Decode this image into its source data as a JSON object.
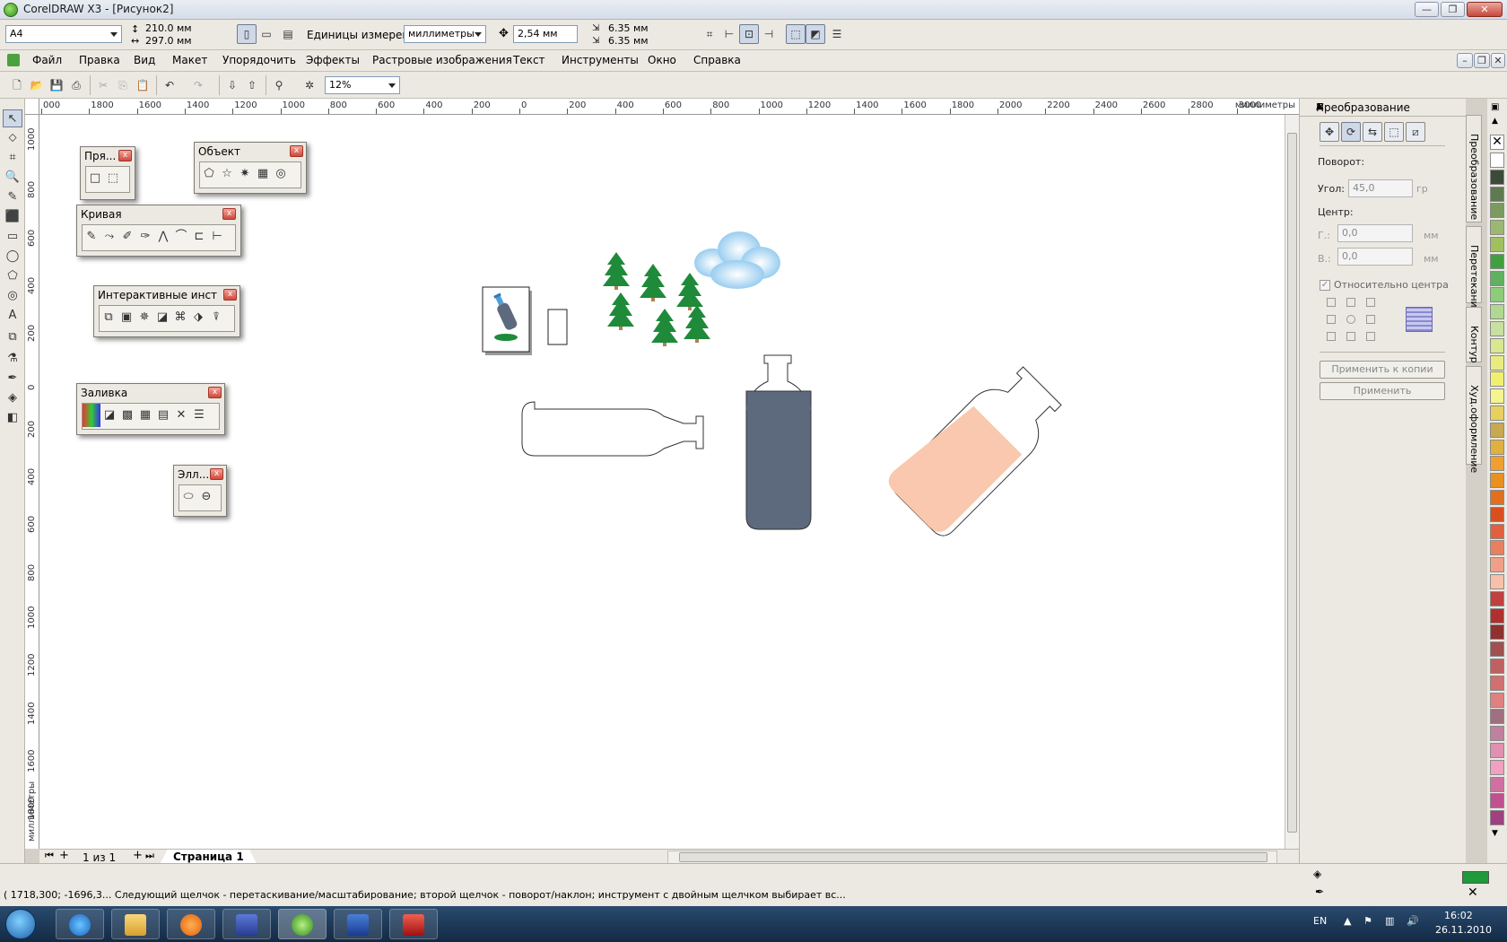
{
  "window": {
    "title": "CorelDRAW X3 - [Рисунок2]",
    "controls": {
      "minimize": "—",
      "restore": "❐",
      "close": "✕"
    }
  },
  "property_bar": {
    "paper_size": "A4",
    "width": "210.0 мм",
    "height": "297.0 мм",
    "units_label": "Единицы измерения:",
    "units_value": "миллиметры",
    "nudge": "2,54 мм",
    "dup_x": "6.35 мм",
    "dup_y": "6.35 мм"
  },
  "menu": {
    "items": [
      "Файл",
      "Правка",
      "Вид",
      "Макет",
      "Упорядочить",
      "Эффекты",
      "Растровые изображения",
      "Текст",
      "Инструменты",
      "Окно",
      "Справка"
    ]
  },
  "standard_bar": {
    "zoom": "12%"
  },
  "ruler": {
    "h_labels": [
      "000",
      "1800",
      "1600",
      "1400",
      "1200",
      "1000",
      "800",
      "600",
      "400",
      "200",
      "0",
      "200",
      "400",
      "600",
      "800",
      "1000",
      "1200",
      "1400",
      "1600",
      "1800",
      "2000",
      "2200",
      "2400",
      "2600",
      "2800",
      "3000"
    ],
    "h_unit": "миллиметры",
    "v_labels": [
      "1000",
      "800",
      "600",
      "400",
      "200",
      "0",
      "200",
      "400",
      "600",
      "800",
      "1000",
      "1200",
      "1400",
      "1600",
      "1800"
    ],
    "v_unit": "миллиметры"
  },
  "palettes": {
    "rect": {
      "title": "Пря..."
    },
    "object": {
      "title": "Объект"
    },
    "curve": {
      "title": "Кривая"
    },
    "interactive": {
      "title": "Интерактивные инструм..."
    },
    "fill": {
      "title": "Заливка"
    },
    "ellipse": {
      "title": "Элл..."
    }
  },
  "page_bar": {
    "count": "1 из 1",
    "tab": "Страница 1"
  },
  "docker": {
    "title": "Преобразование",
    "rotation_label": "Поворот:",
    "angle_label": "Угол:",
    "angle_value": "45,0",
    "angle_unit": "гр",
    "center_label": "Центр:",
    "h_label": "Г.:",
    "h_value": "0,0",
    "h_unit": "мм",
    "v_label": "В.:",
    "v_value": "0,0",
    "v_unit": "мм",
    "relative_label": "Относительно центра",
    "apply_copy": "Применить к копии",
    "apply": "Применить",
    "tabs": [
      "Преобразование",
      "Перетекание",
      "Контур",
      "Худ.оформление"
    ]
  },
  "status": {
    "text": "( 1718,300; -1696,3... Следующий щелчок - перетаскивание/масштабирование; второй щелчок - поворот/наклон; инструмент с двойным щелчком выбирает вс..."
  },
  "taskbar": {
    "lang": "EN",
    "time": "16:02",
    "date": "26.11.2010"
  },
  "colors": {
    "accent": "#5a6a82",
    "bottle_dark": "#5d6a7e",
    "bottle_peach": "#fac8ae",
    "tree_green": "#1f8a3a",
    "cloud_blue": "#9fd0f0"
  },
  "swatches": [
    "#ffffff",
    "#3c4a3a",
    "#5f7a50",
    "#7a9a60",
    "#9cb870",
    "#a0c060",
    "#40a040",
    "#60b060",
    "#8ccc7a",
    "#b0d890",
    "#c8e0a0",
    "#d8e890",
    "#e8ec80",
    "#f0f070",
    "#f4f490",
    "#e8d060",
    "#c8a850",
    "#e0b040",
    "#f0a030",
    "#e89020",
    "#e07020",
    "#d85020",
    "#e06040",
    "#e88060",
    "#f0a088",
    "#f8c0a8",
    "#c04040",
    "#b03030",
    "#903030",
    "#a05050",
    "#c06060",
    "#d07070",
    "#e08080",
    "#a07080",
    "#c080a0",
    "#e090b0",
    "#f0a0c0",
    "#d070a0",
    "#c05090",
    "#a04080"
  ]
}
